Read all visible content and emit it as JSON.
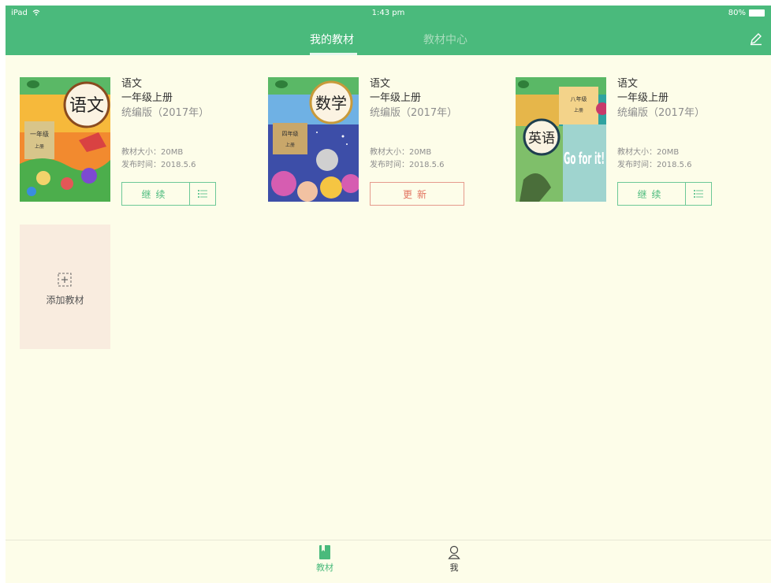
{
  "status": {
    "device": "iPad",
    "time": "1:43 pm",
    "battery": "80%"
  },
  "tabs": {
    "my_textbooks": "我的教材",
    "textbook_center": "教材中心"
  },
  "labels": {
    "size_prefix": "教材大小：",
    "date_prefix": "发布时间："
  },
  "books": [
    {
      "cover_text": "语文",
      "cover_grade": "一年级",
      "cover_term": "上册",
      "subject": "语文",
      "grade": "一年级上册",
      "edition": "统编版（2017年）",
      "size": "教材大小：20MB",
      "date": "发布时间：2018.5.6",
      "action": "继续"
    },
    {
      "cover_text": "数学",
      "cover_grade": "四年级",
      "cover_term": "上册",
      "subject": "语文",
      "grade": "一年级上册",
      "edition": "统编版（2017年）",
      "size": "教材大小：20MB",
      "date": "发布时间：2018.5.6",
      "action": "更新"
    },
    {
      "cover_text": "英语",
      "cover_grade": "八年级",
      "cover_term": "上册",
      "cover_art": "Go for it!",
      "subject": "语文",
      "grade": "一年级上册",
      "edition": "统编版（2017年）",
      "size": "教材大小：20MB",
      "date": "发布时间：2018.5.6",
      "action": "继续"
    }
  ],
  "add_textbook": "添加教材",
  "bottom_tabs": {
    "books": "教材",
    "me": "我"
  },
  "colors": {
    "primary": "#4aba7c",
    "background": "#fdfde9",
    "update": "#e2735f",
    "add_card": "#f9ecdf"
  },
  "icons": [
    "wifi-icon",
    "battery-icon",
    "edit-pencil-icon",
    "list-icon",
    "add-icon",
    "book-icon",
    "person-icon"
  ]
}
